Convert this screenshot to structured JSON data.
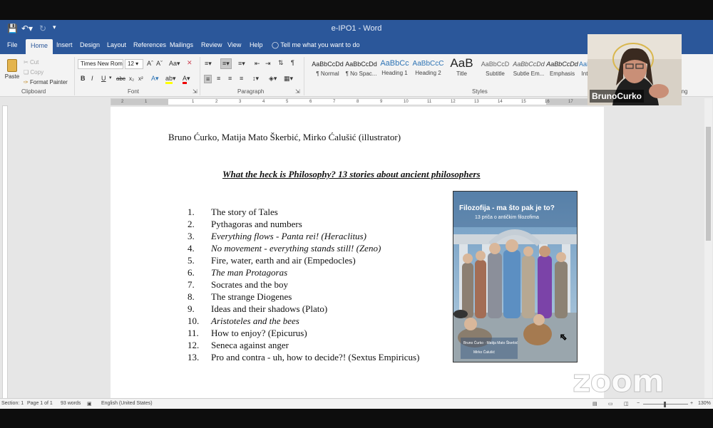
{
  "window": {
    "title": "e-IPO1 - Word"
  },
  "ribbon_tabs": [
    "File",
    "Home",
    "Insert",
    "Design",
    "Layout",
    "References",
    "Mailings",
    "Review",
    "View",
    "Help"
  ],
  "tell_me": "Tell me what you want to do",
  "clipboard": {
    "paste": "Paste",
    "cut": "Cut",
    "copy": "Copy",
    "format_painter": "Format Painter",
    "label": "Clipboard"
  },
  "font": {
    "name": "Times New Rom",
    "size": "12",
    "label": "Font"
  },
  "paragraph": {
    "label": "Paragraph"
  },
  "styles": {
    "label": "Styles",
    "items": [
      {
        "preview": "AaBbCcDd",
        "name": "¶ Normal"
      },
      {
        "preview": "AaBbCcDd",
        "name": "¶ No Spac..."
      },
      {
        "preview": "AaBbCc",
        "name": "Heading 1"
      },
      {
        "preview": "AaBbCcC",
        "name": "Heading 2"
      },
      {
        "preview": "AaB",
        "name": "Title"
      },
      {
        "preview": "AaBbCcD",
        "name": "Subtitle"
      },
      {
        "preview": "AaBbCcDd",
        "name": "Subtle Em..."
      },
      {
        "preview": "AaBbCcDd",
        "name": "Emphasis"
      },
      {
        "preview": "AaBbCcDd",
        "name": "Int"
      }
    ]
  },
  "editing": {
    "label": "Editing"
  },
  "document": {
    "authors": "Bruno Ćurko, Matija Mato Škerbić, Mirko Ćalušić (illustrator)",
    "title": "What the heck is Philosophy? 13 stories about ancient philosophers",
    "toc": [
      {
        "num": "1.",
        "text": "The story of Tales"
      },
      {
        "num": "2.",
        "text": "Pythagoras and numbers"
      },
      {
        "num": "3.",
        "text": "Everything flows - Panta rei! (Heraclitus)"
      },
      {
        "num": "4.",
        "text": "No movement - everything stands still! (Zeno)"
      },
      {
        "num": "5.",
        "text": "Fire, water, earth and air (Empedocles)"
      },
      {
        "num": "6.",
        "text": "The man Protagoras"
      },
      {
        "num": "7.",
        "text": "Socrates and the boy"
      },
      {
        "num": "8.",
        "text": "The strange Diogenes"
      },
      {
        "num": "9.",
        "text": "Ideas and their shadows (Plato)"
      },
      {
        "num": "10.",
        "text": "Aristoteles and the bees"
      },
      {
        "num": "11.",
        "text": "How to enjoy? (Epicurus)"
      },
      {
        "num": "12.",
        "text": "Seneca against anger"
      },
      {
        "num": "13.",
        "text": "Pro and contra - uh, how to decide?! (Sextus Empiricus)"
      }
    ],
    "cover": {
      "title": "Filozofija - ma što pak je to?",
      "subtitle": "13 priča o antičkim filozofima",
      "authors": "Bruno Ćurko · Matija Mato Škerbić",
      "illustrator": "Mirko Ćalušić"
    }
  },
  "statusbar": {
    "section": "Section: 1",
    "page": "Page 1 of 1",
    "words": "93 words",
    "language": "English (United States)",
    "zoom": "130%"
  },
  "zoom_app": {
    "participant_name": "BrunoCurko",
    "logo": "zoom"
  },
  "colors": {
    "word_blue": "#2b579a",
    "ribbon": "#f3f3f3",
    "canvas": "#e6e6e6"
  }
}
